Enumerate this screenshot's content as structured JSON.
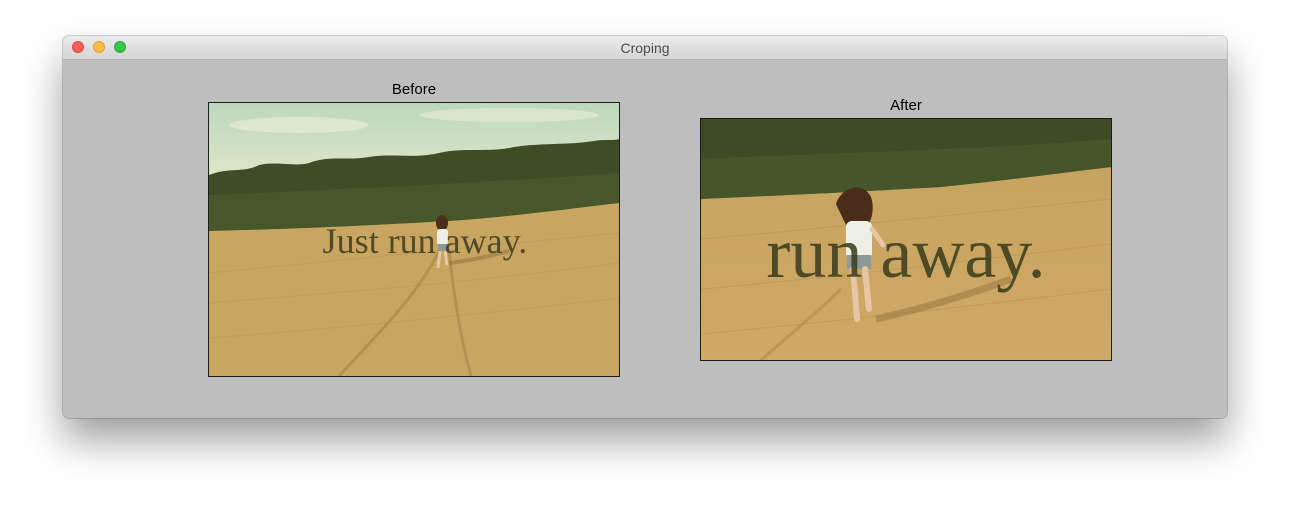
{
  "window": {
    "title": "Croping"
  },
  "before_panel": {
    "label": "Before",
    "overlay_text": "Just run away."
  },
  "after_panel": {
    "label": "After",
    "overlay_text": "run away."
  },
  "colors": {
    "content_background": "#bebebe",
    "sky": "#cfe2c8",
    "trees": "#3d4a25",
    "field": "#c9a45e",
    "overlay_text": "#3a3a1c"
  }
}
